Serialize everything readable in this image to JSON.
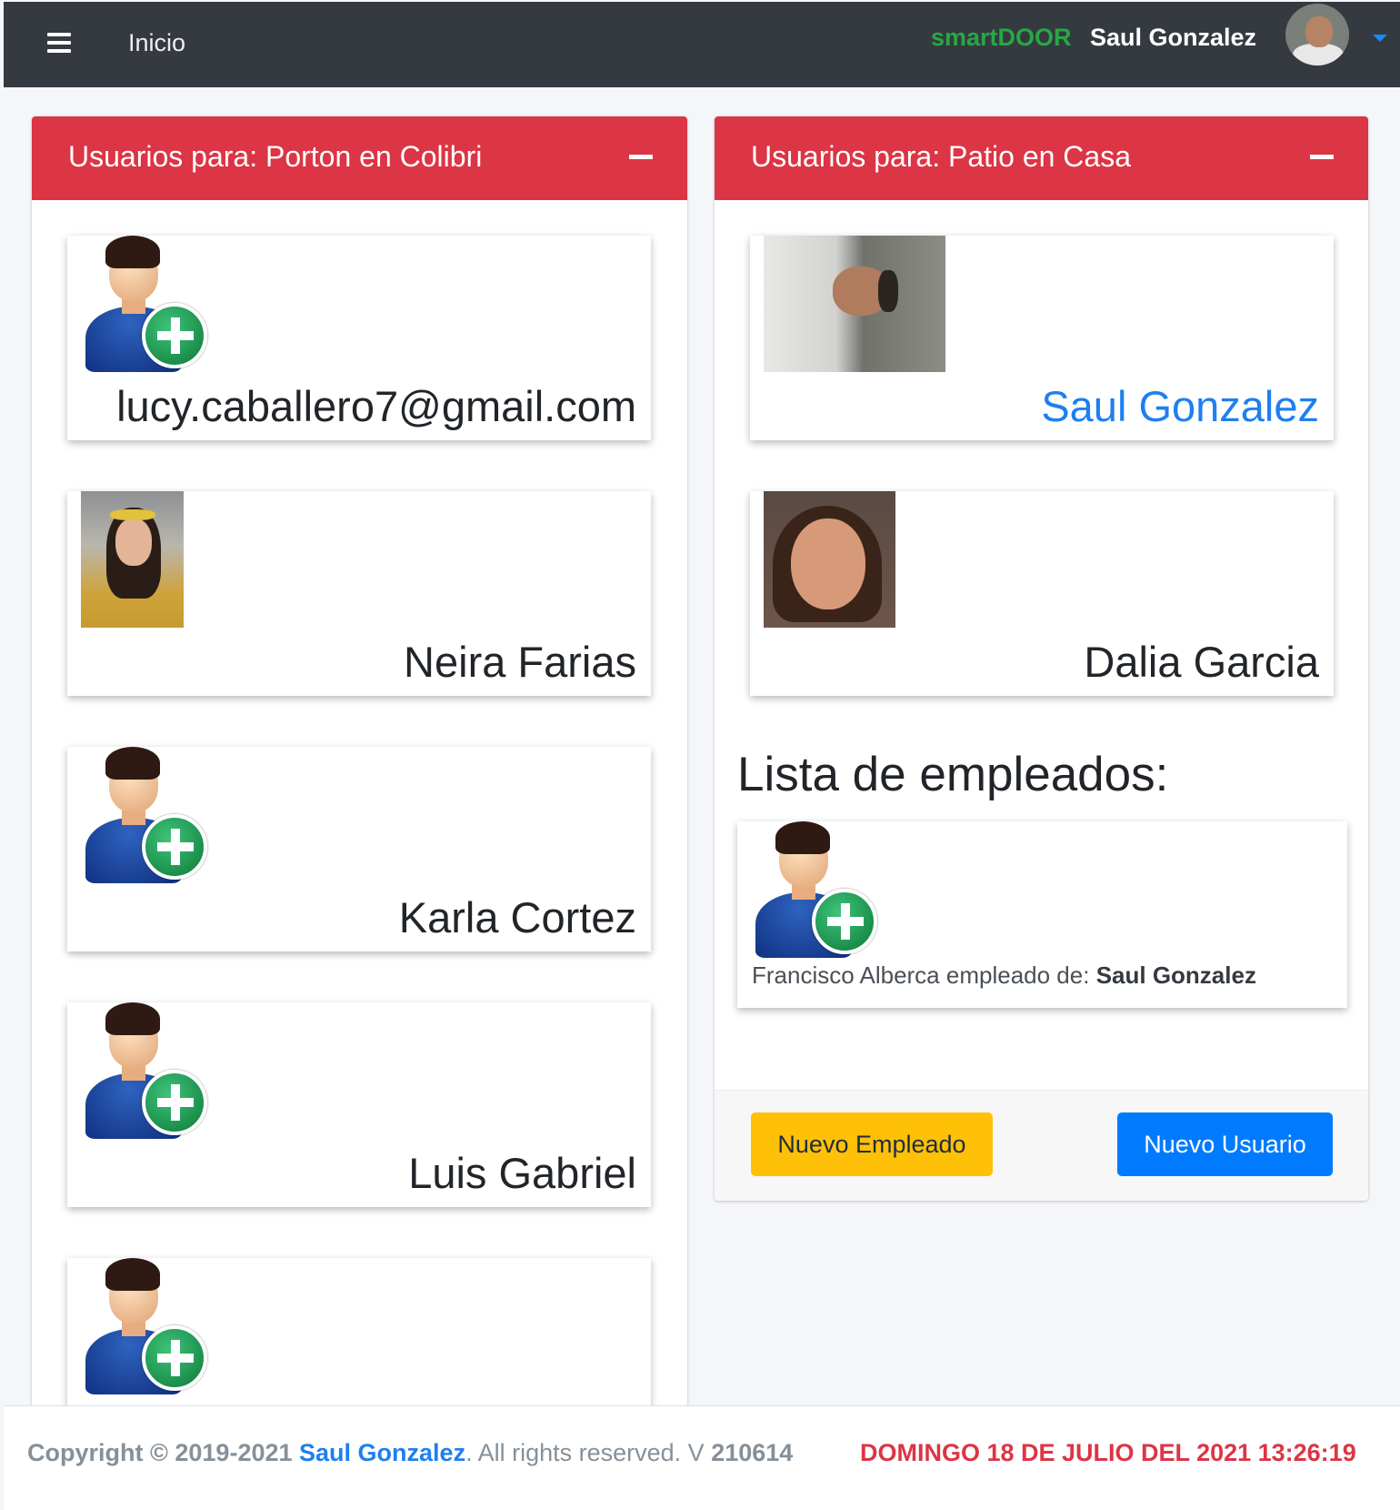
{
  "navbar": {
    "home_label": "Inicio",
    "brand": "smartDOOR",
    "user_name": "Saul Gonzalez"
  },
  "left_panel": {
    "title": "Usuarios para: Porton en Colibri",
    "users": [
      {
        "name": "lucy.caballero7@gmail.com",
        "avatar": "default-user-add-icon"
      },
      {
        "name": "Neira Farias",
        "avatar": "photo"
      },
      {
        "name": "Karla Cortez",
        "avatar": "default-user-add-icon"
      },
      {
        "name": "Luis Gabriel",
        "avatar": "default-user-add-icon"
      },
      {
        "name": "",
        "avatar": "default-user-add-icon"
      }
    ]
  },
  "right_panel": {
    "title": "Usuarios para: Patio en Casa",
    "users": [
      {
        "name": "Saul Gonzalez",
        "avatar": "photo"
      },
      {
        "name": "Dalia Garcia",
        "avatar": "photo"
      }
    ],
    "employees_heading": "Lista de empleados:",
    "employee": {
      "name": "Francisco Alberca",
      "relation": "empleado de:",
      "employer": "Saul Gonzalez"
    },
    "buttons": {
      "new_employee": "Nuevo Empleado",
      "new_user": "Nuevo Usuario"
    }
  },
  "footer": {
    "copyright_prefix": "Copyright © 2019-2021",
    "author": "Saul Gonzalez",
    "rights": ". All rights reserved. V",
    "version": "210614",
    "datetime": "DOMINGO 18 DE JULIO DEL 2021 13:26:19"
  },
  "colors": {
    "card_header": "#dc3545",
    "navbar": "#343a40",
    "brand": "#28a745",
    "link": "#1e7ff0",
    "warning_button": "#ffc107",
    "primary_button": "#007bff"
  }
}
